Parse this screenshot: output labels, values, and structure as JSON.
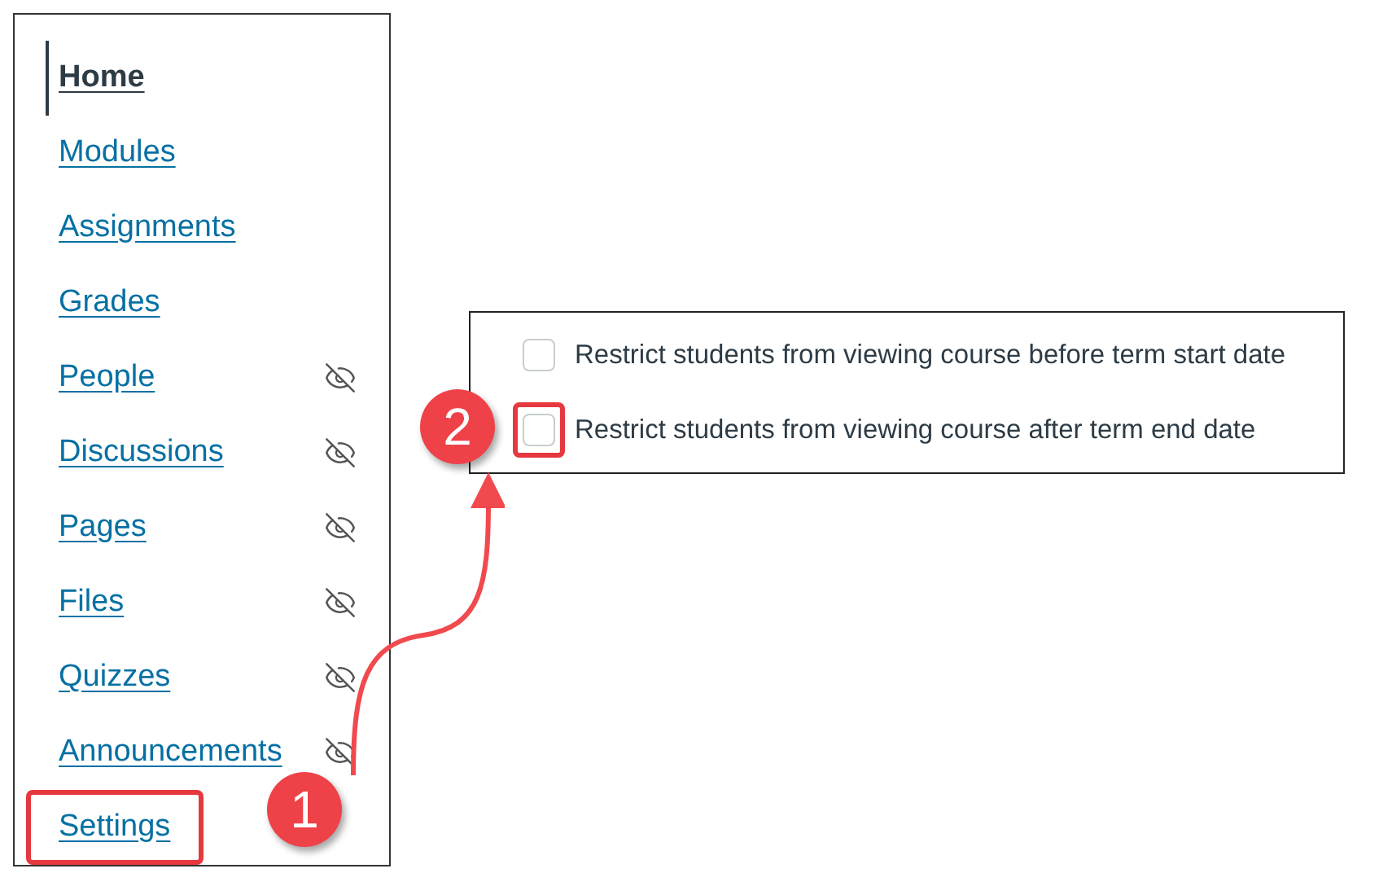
{
  "nav": {
    "items": [
      {
        "label": "Home",
        "selected": true,
        "hidden": false,
        "highlighted": false
      },
      {
        "label": "Modules",
        "selected": false,
        "hidden": false,
        "highlighted": false
      },
      {
        "label": "Assignments",
        "selected": false,
        "hidden": false,
        "highlighted": false
      },
      {
        "label": "Grades",
        "selected": false,
        "hidden": false,
        "highlighted": false
      },
      {
        "label": "People",
        "selected": false,
        "hidden": true,
        "highlighted": false
      },
      {
        "label": "Discussions",
        "selected": false,
        "hidden": true,
        "highlighted": false
      },
      {
        "label": "Pages",
        "selected": false,
        "hidden": true,
        "highlighted": false
      },
      {
        "label": "Files",
        "selected": false,
        "hidden": true,
        "highlighted": false
      },
      {
        "label": "Quizzes",
        "selected": false,
        "hidden": true,
        "highlighted": false
      },
      {
        "label": "Announcements",
        "selected": false,
        "hidden": true,
        "highlighted": false
      },
      {
        "label": "Settings",
        "selected": false,
        "hidden": false,
        "highlighted": true
      }
    ]
  },
  "options": [
    {
      "label": "Restrict students from viewing course before term start date",
      "checked": false,
      "highlighted": false
    },
    {
      "label": "Restrict students from viewing course after term end date",
      "checked": false,
      "highlighted": true
    }
  ],
  "step_badges": [
    "1",
    "2"
  ]
}
